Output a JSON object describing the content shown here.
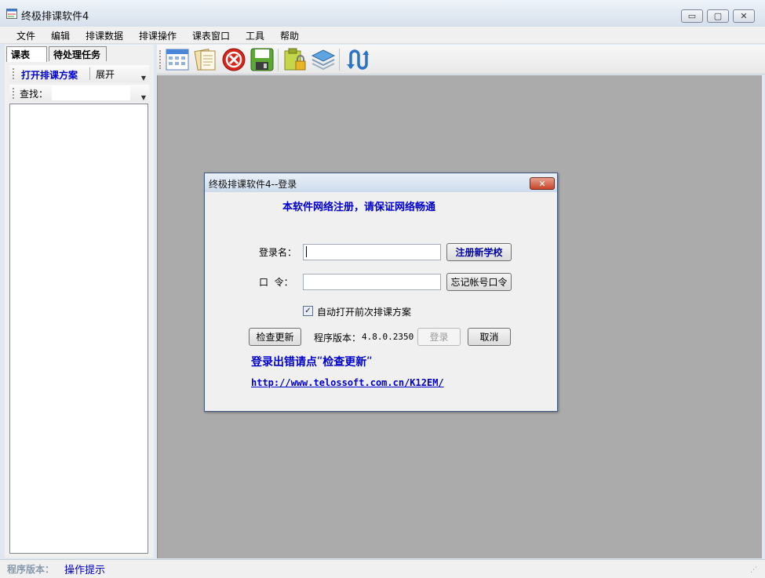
{
  "window": {
    "title": "终极排课软件4",
    "controls": {
      "minimize": "▭",
      "maximize": "▢",
      "close": "✕"
    }
  },
  "menu": [
    "文件",
    "编辑",
    "排课数据",
    "排课操作",
    "课表窗口",
    "工具",
    "帮助"
  ],
  "left_panel": {
    "tabs": [
      "课表",
      "待处理任务"
    ],
    "toolbar": {
      "open_plan": "打开排课方案",
      "expand": "展开"
    },
    "find_label": "查找："
  },
  "toolbar_icons": [
    "schedule-grid-icon",
    "documents-icon",
    "stop-icon",
    "save-icon",
    "lock-clipboard-icon",
    "layers-icon",
    "swap-icon"
  ],
  "status": {
    "version_label": "程序版本：",
    "hint": "操作提示"
  },
  "dialog": {
    "title": "终极排课软件4--登录",
    "close": "✕",
    "notice": "本软件网络注册，请保证网络畅通",
    "login_label": "登录名：",
    "login_value": "",
    "register_button": "注册新学校",
    "password_label": "口  令：",
    "password_value": "",
    "forgot_button": "忘记帐号口令",
    "auto_open_label": "自动打开前次排课方案",
    "auto_open_checked": true,
    "check_update_button": "检查更新",
    "version_label": "程序版本：",
    "version_value": "4.8.0.2350",
    "login_button": "登录",
    "cancel_button": "取消",
    "error_hint": "登录出错请点ʺ检查更新ʺ",
    "url": "http://www.telossoft.com.cn/K12EM/"
  },
  "colors": {
    "accent_blue": "#0000cc",
    "mdi_background": "#ababab"
  }
}
